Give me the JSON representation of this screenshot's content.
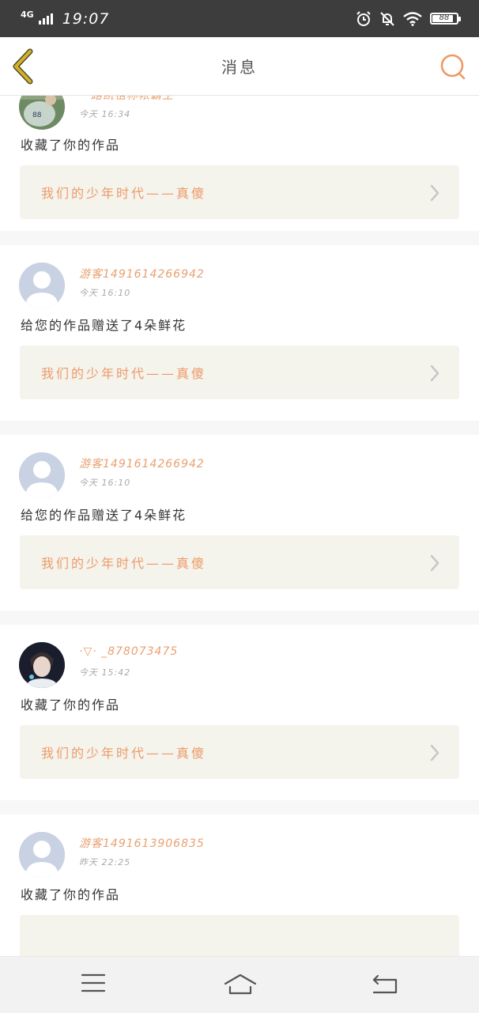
{
  "status_bar": {
    "network": "4G",
    "time": "19:07",
    "battery": "88",
    "battery_level": 0.88,
    "icons": [
      "signal-icon",
      "alarm-icon",
      "notifications-off-icon",
      "wifi-icon",
      "battery-icon"
    ]
  },
  "header": {
    "title": "消息",
    "back_icon": "back-chevron-icon",
    "search_icon": "search-icon"
  },
  "colors": {
    "accent": "#ed9a68",
    "back_icon": "#d6b126",
    "status_bar_bg": "#3d3d3d",
    "work_box_bg": "#f4f3ec",
    "default_avatar": "#c9d2e3"
  },
  "messages": [
    {
      "user_name": "一路凯祖称帐霸主",
      "time": "今天 16:34",
      "action": "收藏了你的作品",
      "work_title": "我们的少年时代——真傻",
      "avatar": "photo-avatar-baseball"
    },
    {
      "user_name": "游客1491614266942",
      "time": "今天 16:10",
      "action": "给您的作品赠送了4朵鲜花",
      "work_title": "我们的少年时代——真傻",
      "avatar": "default-avatar"
    },
    {
      "user_name": "游客1491614266942",
      "time": "今天 16:10",
      "action": "给您的作品赠送了4朵鲜花",
      "work_title": "我们的少年时代——真傻",
      "avatar": "default-avatar"
    },
    {
      "user_name": "·▽· _878073475",
      "time": "今天 15:42",
      "action": "收藏了你的作品",
      "work_title": "我们的少年时代——真傻",
      "avatar": "photo-avatar-person"
    },
    {
      "user_name": "游客1491613906835",
      "time": "昨天 22:25",
      "action": "收藏了你的作品",
      "work_title": "",
      "avatar": "default-avatar"
    }
  ],
  "nav": {
    "menu_icon": "menu-icon",
    "home_icon": "home-icon",
    "back_icon": "return-icon"
  }
}
